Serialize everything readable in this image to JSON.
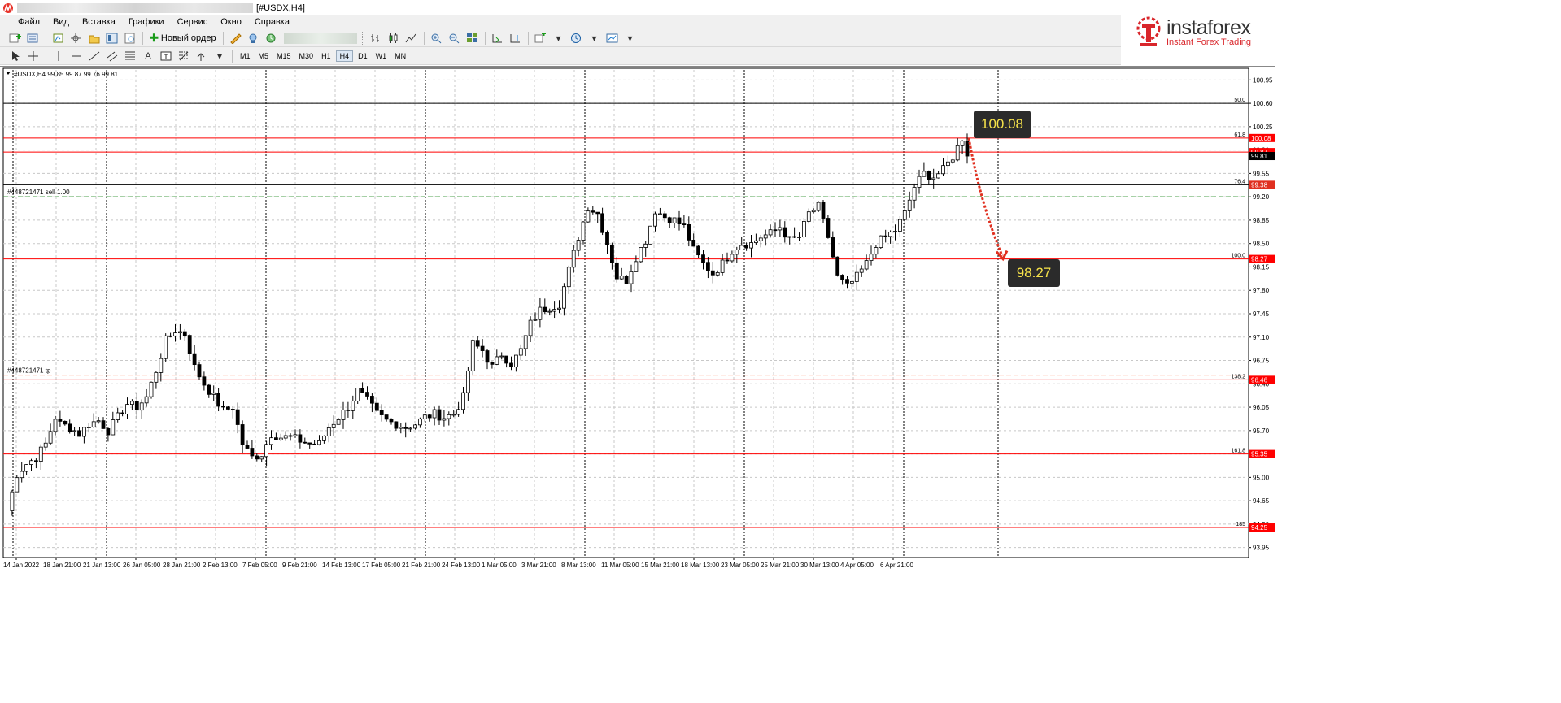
{
  "window": {
    "title": "[#USDX,H4]"
  },
  "menu": [
    {
      "label": "Файл"
    },
    {
      "label": "Вид"
    },
    {
      "label": "Вставка"
    },
    {
      "label": "Графики"
    },
    {
      "label": "Сервис"
    },
    {
      "label": "Окно"
    },
    {
      "label": "Справка"
    }
  ],
  "toolbar": {
    "new_order_label": "Новый ордер",
    "timeframes": [
      "M1",
      "M5",
      "M15",
      "M30",
      "H1",
      "H4",
      "D1",
      "W1",
      "MN"
    ],
    "active_timeframe": "H4"
  },
  "logo": {
    "name": "instaforex",
    "tagline": "Instant Forex Trading",
    "brand_color": "#d9262b"
  },
  "chart": {
    "header": "#USDX,H4  99.85 99.87 99.76 99.81",
    "current_price": "99.81",
    "order_label": "#448721471 sell 1.00",
    "tp_label": "#448721471 tp",
    "callout_high": "100.08",
    "callout_low": "98.27",
    "fib_labels": [
      {
        "text": "50.0",
        "price": 100.6
      },
      {
        "text": "61.8",
        "price": 100.08
      },
      {
        "text": "76.4",
        "price": 99.38
      },
      {
        "text": "100.0",
        "price": 98.27
      },
      {
        "text": "138.2",
        "price": 96.46
      },
      {
        "text": "161.8",
        "price": 95.35
      },
      {
        "text": "185",
        "price": 94.25
      }
    ]
  },
  "chart_data": {
    "type": "candlestick",
    "symbol": "#USDX",
    "timeframe": "H4",
    "ylim": [
      93.8,
      101.1
    ],
    "y_ticks": [
      "100.95",
      "100.60",
      "100.25",
      "99.90",
      "99.55",
      "99.20",
      "98.85",
      "98.50",
      "98.15",
      "97.80",
      "97.45",
      "97.10",
      "96.75",
      "96.40",
      "96.05",
      "95.70",
      "95.35",
      "95.00",
      "94.65",
      "94.30",
      "93.95"
    ],
    "x_ticks": [
      "14 Jan 2022",
      "18 Jan 21:00",
      "21 Jan 13:00",
      "26 Jan 05:00",
      "28 Jan 21:00",
      "2 Feb 13:00",
      "7 Feb 05:00",
      "9 Feb 21:00",
      "14 Feb 13:00",
      "17 Feb 05:00",
      "21 Feb 21:00",
      "24 Feb 13:00",
      "1 Mar 05:00",
      "3 Mar 21:00",
      "8 Mar 13:00",
      "11 Mar 05:00",
      "15 Mar 21:00",
      "18 Mar 13:00",
      "23 Mar 05:00",
      "25 Mar 21:00",
      "30 Mar 13:00",
      "4 Apr 05:00",
      "6 Apr 21:00"
    ],
    "horizontal_levels": [
      {
        "price": 100.6,
        "color": "#000000",
        "label": "50.0"
      },
      {
        "price": 100.08,
        "color": "#ff0000",
        "label": "61.8",
        "price_tag": "100.08"
      },
      {
        "price": 99.87,
        "color": "#ff0000",
        "price_tag": "99.87"
      },
      {
        "price": 99.38,
        "color": "#000000",
        "label": "76.4",
        "price_tag": "99.38"
      },
      {
        "price": 98.27,
        "color": "#ff0000",
        "label": "100.0",
        "price_tag": "98.27"
      },
      {
        "price": 96.46,
        "color": "#ff0000",
        "label": "138.2",
        "price_tag": "96.46"
      },
      {
        "price": 95.35,
        "color": "#ff0000",
        "label": "161.8",
        "price_tag": "95.35"
      },
      {
        "price": 94.25,
        "color": "#ff0000",
        "label": "185",
        "price_tag": "94.25"
      }
    ],
    "order_line": {
      "price": 99.2,
      "color": "#1a8a1a",
      "label": "#448721471 sell 1.00"
    },
    "tp_line": {
      "price": 96.53,
      "color": "#ff6a3d",
      "label": "#448721471 tp"
    },
    "forecast_arrow": {
      "from": 100.08,
      "to": 98.27,
      "color": "#e03020"
    },
    "path": [
      [
        0,
        94.5
      ],
      [
        2,
        95.05
      ],
      [
        4,
        95.2
      ],
      [
        6,
        95.3
      ],
      [
        8,
        95.5
      ],
      [
        10,
        95.9
      ],
      [
        11,
        95.8
      ],
      [
        13,
        95.75
      ],
      [
        15,
        95.65
      ],
      [
        17,
        95.8
      ],
      [
        19,
        95.85
      ],
      [
        21,
        95.7
      ],
      [
        23,
        95.9
      ],
      [
        25,
        96.1
      ],
      [
        27,
        96.05
      ],
      [
        29,
        96.2
      ],
      [
        31,
        96.6
      ],
      [
        33,
        97.05
      ],
      [
        35,
        97.2
      ],
      [
        37,
        97.15
      ],
      [
        39,
        96.65
      ],
      [
        41,
        96.4
      ],
      [
        43,
        96.2
      ],
      [
        45,
        96.0
      ],
      [
        47,
        96.05
      ],
      [
        49,
        95.5
      ],
      [
        51,
        95.3
      ],
      [
        53,
        95.35
      ],
      [
        55,
        95.65
      ],
      [
        57,
        95.6
      ],
      [
        59,
        95.6
      ],
      [
        61,
        95.55
      ],
      [
        63,
        95.5
      ],
      [
        65,
        95.5
      ],
      [
        67,
        95.75
      ],
      [
        69,
        95.9
      ],
      [
        71,
        96.05
      ],
      [
        73,
        96.3
      ],
      [
        75,
        96.15
      ],
      [
        77,
        95.95
      ],
      [
        79,
        95.85
      ],
      [
        81,
        95.8
      ],
      [
        83,
        95.75
      ],
      [
        85,
        95.8
      ],
      [
        87,
        95.9
      ],
      [
        89,
        95.95
      ],
      [
        91,
        95.9
      ],
      [
        93,
        95.95
      ],
      [
        95,
        96.2
      ],
      [
        97,
        97.0
      ],
      [
        99,
        96.9
      ],
      [
        101,
        96.65
      ],
      [
        103,
        96.85
      ],
      [
        105,
        96.7
      ],
      [
        107,
        96.9
      ],
      [
        109,
        97.3
      ],
      [
        111,
        97.5
      ],
      [
        113,
        97.55
      ],
      [
        115,
        97.6
      ],
      [
        117,
        98.1
      ],
      [
        119,
        98.6
      ],
      [
        121,
        99.05
      ],
      [
        123,
        98.95
      ],
      [
        125,
        98.5
      ],
      [
        127,
        98.0
      ],
      [
        129,
        97.95
      ],
      [
        131,
        98.3
      ],
      [
        133,
        98.55
      ],
      [
        135,
        99.0
      ],
      [
        137,
        98.9
      ],
      [
        139,
        98.85
      ],
      [
        141,
        98.75
      ],
      [
        143,
        98.4
      ],
      [
        145,
        98.2
      ],
      [
        147,
        98.05
      ],
      [
        149,
        98.2
      ],
      [
        151,
        98.4
      ],
      [
        153,
        98.5
      ],
      [
        155,
        98.5
      ],
      [
        157,
        98.6
      ],
      [
        159,
        98.65
      ],
      [
        161,
        98.75
      ],
      [
        163,
        98.55
      ],
      [
        165,
        98.6
      ],
      [
        167,
        98.95
      ],
      [
        169,
        99.05
      ],
      [
        171,
        98.6
      ],
      [
        173,
        98.0
      ],
      [
        175,
        97.85
      ],
      [
        177,
        98.0
      ],
      [
        179,
        98.2
      ],
      [
        181,
        98.5
      ],
      [
        183,
        98.6
      ],
      [
        185,
        98.7
      ],
      [
        187,
        98.95
      ],
      [
        189,
        99.35
      ],
      [
        191,
        99.55
      ],
      [
        193,
        99.5
      ],
      [
        195,
        99.6
      ],
      [
        197,
        99.8
      ],
      [
        199,
        100.08
      ],
      [
        200,
        99.81
      ]
    ]
  }
}
